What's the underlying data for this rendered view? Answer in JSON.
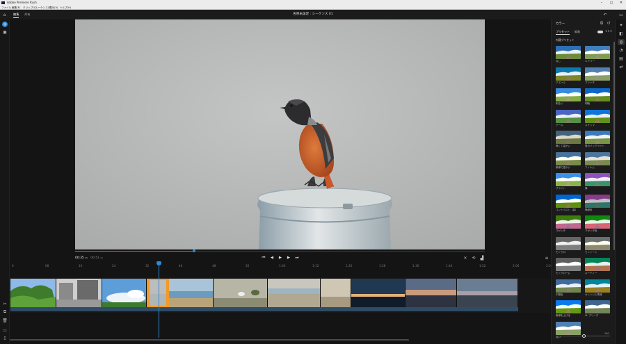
{
  "window": {
    "title": "Adobe Premiere Rush",
    "min": "–",
    "max": "◻",
    "close": "✕"
  },
  "menu": [
    "ファイル",
    "編集(E)",
    "クリップ(C)",
    "シーケンス(S)",
    "表示(V)",
    "ヘルプ(H)"
  ],
  "header": {
    "tabs": [
      "編集",
      "共有"
    ],
    "project_title": "名称未設定 : シーケンス 01"
  },
  "viewer": {
    "time_current": "00:35",
    "time_current_frames": "08",
    "time_total": "00:51",
    "time_total_frames": "05"
  },
  "ruler_ticks": [
    "0",
    "08",
    "16",
    "24",
    "32",
    "40",
    "48",
    "56",
    "1:04",
    "1:12",
    "1:20",
    "1:28",
    "1:36",
    "1:44",
    "1:52",
    "2:00",
    "2:08"
  ],
  "panel": {
    "title": "カラー",
    "tabs": [
      "プリセット",
      "編集"
    ],
    "group": "内蔵プリセット",
    "presets": [
      "なし",
      "エアリー",
      "アズール",
      "ブリーチ",
      "明るい",
      "明暗",
      "クール",
      "スナップ",
      "暗くて温かい",
      "昼のバックライト",
      "新緑で温かい",
      "フィルム",
      "ブライト",
      "緑",
      "コントラスト（高）",
      "暗緑色",
      "マゼンタ",
      "マゼンタ色",
      "モノクロ",
      "モノトーン",
      "モノクローム",
      "ルーティー",
      "中間色",
      "オレンジと青緑",
      "新緑を上げる",
      "SL ブリーチ",
      "淡い"
    ],
    "strength": "100"
  },
  "colors": {
    "accent": "#2e8bd6",
    "selected_clip": "#f09a28"
  }
}
